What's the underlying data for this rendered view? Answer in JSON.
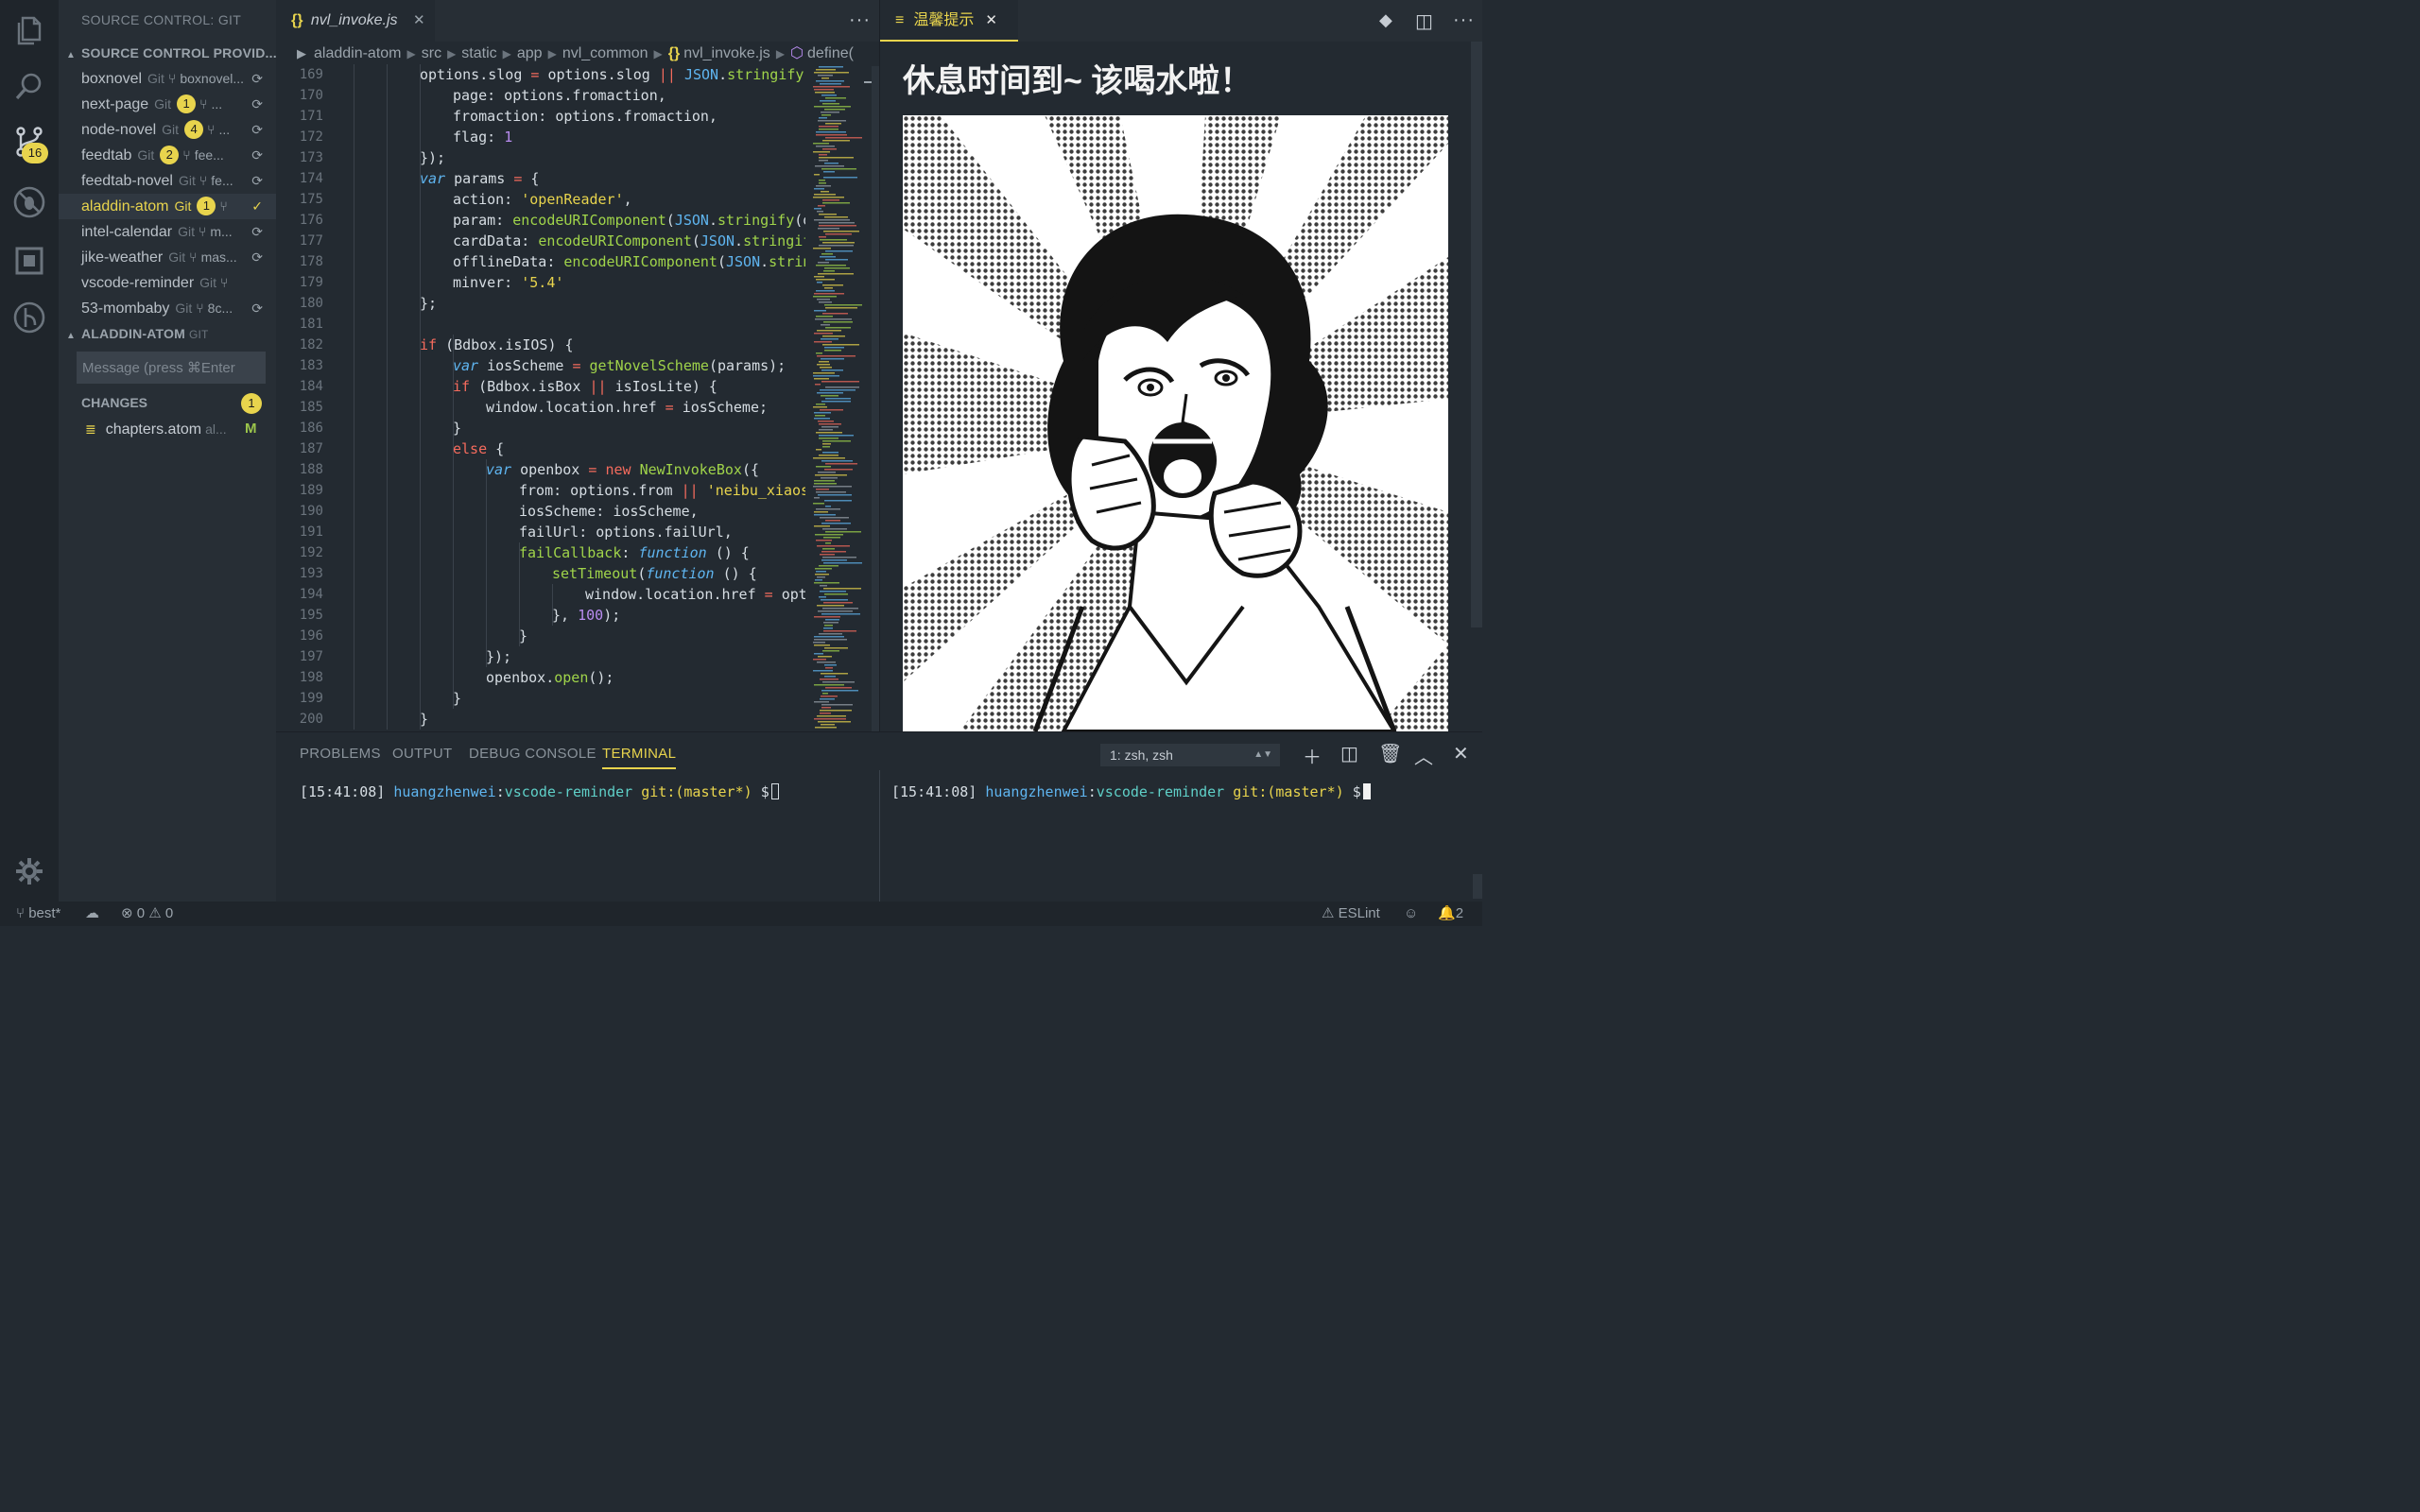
{
  "activity": {
    "scm_badge": "16"
  },
  "sidebar": {
    "title": "SOURCE CONTROL: GIT",
    "providers_header": "SOURCE CONTROL PROVID...",
    "repos": [
      {
        "name": "boxnovel",
        "git": "Git",
        "badge": "",
        "branch": "boxnovel...",
        "sync": true
      },
      {
        "name": "next-page",
        "git": "Git",
        "badge": "1",
        "branch": "...",
        "sync": true
      },
      {
        "name": "node-novel",
        "git": "Git",
        "badge": "4",
        "branch": "...",
        "sync": true
      },
      {
        "name": "feedtab",
        "git": "Git",
        "badge": "2",
        "branch": "fee...",
        "sync": true
      },
      {
        "name": "feedtab-novel",
        "git": "Git",
        "badge": "",
        "branch": "fe...",
        "sync": true
      },
      {
        "name": "aladdin-atom",
        "git": "Git",
        "badge": "1",
        "branch": "",
        "sync": false
      },
      {
        "name": "intel-calendar",
        "git": "Git",
        "badge": "",
        "branch": "m...",
        "sync": true
      },
      {
        "name": "jike-weather",
        "git": "Git",
        "badge": "",
        "branch": "mas...",
        "sync": true
      },
      {
        "name": "vscode-reminder",
        "git": "Git",
        "badge": "",
        "branch": "",
        "sync": false
      },
      {
        "name": "53-mombaby",
        "git": "Git",
        "badge": "",
        "branch": "8c...",
        "sync": true
      }
    ],
    "repo_header": "ALADDIN-ATOM",
    "repo_header_sub": "GIT",
    "message_placeholder": "Message (press ⌘Enter",
    "changes_label": "CHANGES",
    "changes_count": "1",
    "change_file": "chapters.atom",
    "change_path": "al...",
    "change_status": "M"
  },
  "editor": {
    "tab_label": "nvl_invoke.js",
    "tab_icon": "{}",
    "breadcrumb": [
      "aladdin-atom",
      "src",
      "static",
      "app",
      "nvl_common",
      "nvl_invoke.js",
      "define("
    ],
    "line_numbers": [
      "169",
      "170",
      "171",
      "172",
      "173",
      "174",
      "175",
      "176",
      "177",
      "178",
      "179",
      "180",
      "181",
      "182",
      "183",
      "184",
      "185",
      "186",
      "187",
      "188",
      "189",
      "190",
      "191",
      "192",
      "193",
      "194",
      "195",
      "196",
      "197",
      "198",
      "199",
      "200"
    ]
  },
  "webview": {
    "tab_label": "温馨提示",
    "heading": "休息时间到~ 该喝水啦！"
  },
  "panel": {
    "tabs": [
      "PROBLEMS",
      "OUTPUT",
      "DEBUG CONSOLE",
      "TERMINAL"
    ],
    "active_tab": "TERMINAL",
    "terminal_select": "1: zsh, zsh",
    "prompt_time": "[15:41:08]",
    "prompt_user": "huangzhenwei",
    "prompt_sep": ":",
    "prompt_dir": "vscode-reminder",
    "prompt_git": "git:(master*)",
    "prompt_symbol": "$"
  },
  "status": {
    "branch": "best*",
    "errors": "0",
    "warnings": "0",
    "eslint": "ESLint",
    "notifications": "2"
  },
  "colors": {
    "accent": "#e8d44d",
    "background": "#232a31",
    "sidebar": "#272e35"
  }
}
